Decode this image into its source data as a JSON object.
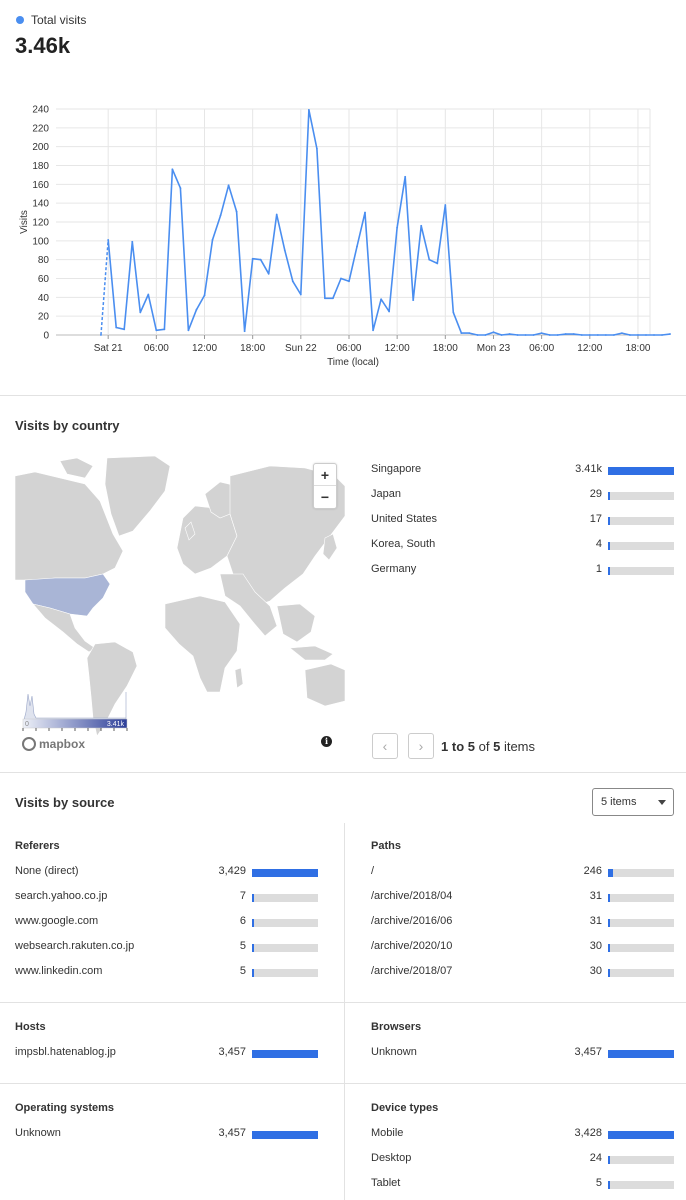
{
  "summary": {
    "legend_label": "Total visits",
    "total": "3.46k",
    "series_color": "#4a8ef0"
  },
  "chart_data": {
    "type": "line",
    "ylabel": "Visits",
    "xlabel": "Time (local)",
    "ylim": [
      0,
      240
    ],
    "yticks": [
      0,
      20,
      40,
      60,
      80,
      100,
      120,
      140,
      160,
      180,
      200,
      220,
      240
    ],
    "xlim_hours": [
      -6.5,
      67.5
    ],
    "xticks": [
      {
        "label": "Sat 21",
        "hour": 0
      },
      {
        "label": "06:00",
        "hour": 6
      },
      {
        "label": "12:00",
        "hour": 12
      },
      {
        "label": "18:00",
        "hour": 18
      },
      {
        "label": "Sun 22",
        "hour": 24
      },
      {
        "label": "06:00",
        "hour": 30
      },
      {
        "label": "12:00",
        "hour": 36
      },
      {
        "label": "18:00",
        "hour": 42
      },
      {
        "label": "Mon 23",
        "hour": 48
      },
      {
        "label": "06:00",
        "hour": 54
      },
      {
        "label": "12:00",
        "hour": 60
      },
      {
        "label": "18:00",
        "hour": 66
      }
    ],
    "grid": true,
    "series": [
      {
        "values": [
          [
            -0.9,
            0
          ],
          [
            0,
            101
          ],
          [
            1,
            8
          ],
          [
            2,
            6
          ],
          [
            3,
            99
          ],
          [
            4,
            24
          ],
          [
            5,
            43
          ],
          [
            6,
            5
          ],
          [
            7,
            6
          ],
          [
            8,
            176
          ],
          [
            9,
            156
          ],
          [
            10,
            5
          ],
          [
            11,
            27
          ],
          [
            12,
            42
          ],
          [
            13,
            101
          ],
          [
            14,
            127
          ],
          [
            15,
            159
          ],
          [
            16,
            131
          ],
          [
            17,
            4
          ],
          [
            18,
            81
          ],
          [
            19,
            80
          ],
          [
            20,
            65
          ],
          [
            21,
            128
          ],
          [
            22,
            90
          ],
          [
            23,
            57
          ],
          [
            24,
            43
          ],
          [
            25,
            239
          ],
          [
            26,
            198
          ],
          [
            27,
            39
          ],
          [
            28,
            39
          ],
          [
            29,
            60
          ],
          [
            30,
            57
          ],
          [
            31,
            94
          ],
          [
            32,
            130
          ],
          [
            33,
            5
          ],
          [
            34,
            38
          ],
          [
            35,
            25
          ],
          [
            36,
            114
          ],
          [
            37,
            168
          ],
          [
            38,
            37
          ],
          [
            39,
            116
          ],
          [
            40,
            80
          ],
          [
            41,
            76
          ],
          [
            42,
            138
          ],
          [
            43,
            24
          ],
          [
            44,
            2
          ],
          [
            45,
            2
          ],
          [
            46,
            0
          ],
          [
            47,
            0
          ],
          [
            48,
            3
          ],
          [
            49,
            0
          ],
          [
            50,
            1
          ],
          [
            51,
            0
          ],
          [
            52,
            0
          ],
          [
            53,
            0
          ],
          [
            54,
            2
          ],
          [
            55,
            0
          ],
          [
            56,
            0
          ],
          [
            57,
            1
          ],
          [
            58,
            1
          ],
          [
            59,
            0
          ],
          [
            60,
            0
          ],
          [
            61,
            0
          ],
          [
            62,
            0
          ],
          [
            63,
            0
          ],
          [
            64,
            2
          ],
          [
            65,
            0
          ],
          [
            66,
            0
          ],
          [
            67,
            0
          ],
          [
            68,
            0
          ],
          [
            69,
            0
          ],
          [
            70,
            1
          ]
        ]
      }
    ]
  },
  "country": {
    "title": "Visits by country",
    "zoom_in": "+",
    "zoom_out": "−",
    "legend_min": "0",
    "legend_max": "3.41k",
    "attribution": "mapbox",
    "info_icon": "i",
    "max": 3410,
    "items": [
      {
        "name": "Singapore",
        "value": "3.41k",
        "fraction": 1.0
      },
      {
        "name": "Japan",
        "value": "29",
        "fraction": 0.0085
      },
      {
        "name": "United States",
        "value": "17",
        "fraction": 0.005
      },
      {
        "name": "Korea, South",
        "value": "4",
        "fraction": 0.0012
      },
      {
        "name": "Germany",
        "value": "1",
        "fraction": 0.0003
      }
    ],
    "pager": {
      "prev": "‹",
      "next": "›",
      "from": "1",
      "to_word": "to",
      "to": "5",
      "of_word": "of",
      "total": "5",
      "items_word": "items"
    }
  },
  "source": {
    "title": "Visits by source",
    "select_value": "5 items",
    "referers": {
      "title": "Referers",
      "items": [
        {
          "name": "None (direct)",
          "value": "3,429",
          "fraction": 1.0
        },
        {
          "name": "search.yahoo.co.jp",
          "value": "7",
          "fraction": 0.002
        },
        {
          "name": "www.google.com",
          "value": "6",
          "fraction": 0.0018
        },
        {
          "name": "websearch.rakuten.co.jp",
          "value": "5",
          "fraction": 0.0015
        },
        {
          "name": "www.linkedin.com",
          "value": "5",
          "fraction": 0.0015
        }
      ]
    },
    "paths": {
      "title": "Paths",
      "items": [
        {
          "name": "/",
          "value": "246",
          "fraction": 0.071
        },
        {
          "name": "/archive/2018/04",
          "value": "31",
          "fraction": 0.009
        },
        {
          "name": "/archive/2016/06",
          "value": "31",
          "fraction": 0.009
        },
        {
          "name": "/archive/2020/10",
          "value": "30",
          "fraction": 0.009
        },
        {
          "name": "/archive/2018/07",
          "value": "30",
          "fraction": 0.009
        }
      ]
    },
    "hosts": {
      "title": "Hosts",
      "items": [
        {
          "name": "impsbl.hatenablog.jp",
          "value": "3,457",
          "fraction": 1.0
        }
      ]
    },
    "browsers": {
      "title": "Browsers",
      "items": [
        {
          "name": "Unknown",
          "value": "3,457",
          "fraction": 1.0
        }
      ]
    },
    "os": {
      "title": "Operating systems",
      "items": [
        {
          "name": "Unknown",
          "value": "3,457",
          "fraction": 1.0
        }
      ]
    },
    "devices": {
      "title": "Device types",
      "items": [
        {
          "name": "Mobile",
          "value": "3,428",
          "fraction": 1.0
        },
        {
          "name": "Desktop",
          "value": "24",
          "fraction": 0.007
        },
        {
          "name": "Tablet",
          "value": "5",
          "fraction": 0.0015
        }
      ]
    }
  },
  "colors": {
    "accent": "#2f6fe4",
    "bar_bg": "#dcdcdc",
    "map_land": "#d3d3d3",
    "map_highlight": "#a9b5d6"
  }
}
